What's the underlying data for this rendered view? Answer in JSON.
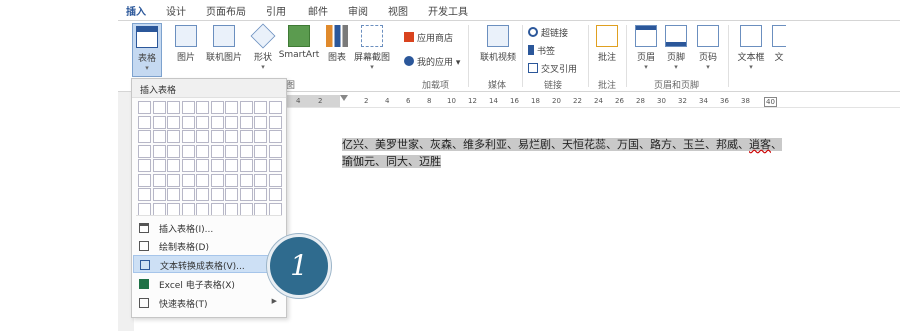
{
  "tabs": [
    "插入",
    "设计",
    "页面布局",
    "引用",
    "邮件",
    "审阅",
    "视图",
    "开发工具"
  ],
  "active_tab": "插入",
  "ribbon": {
    "table": "表格",
    "picture": "图片",
    "online_picture": "联机图片",
    "shapes": "形状",
    "smartart": "SmartArt",
    "chart": "图表",
    "screenshot": "屏幕截图",
    "app_store": "应用商店",
    "my_apps": "我的应用",
    "online_video": "联机视频",
    "hyperlink": "超链接",
    "bookmark": "书签",
    "cross_ref": "交叉引用",
    "comment": "批注",
    "header": "页眉",
    "footer": "页脚",
    "page_number": "页码",
    "textbox": "文本框",
    "groups": {
      "illustrations": "图",
      "addins": "加载项",
      "media": "媒体",
      "links": "链接",
      "comments": "批注",
      "header_footer": "页眉和页脚"
    }
  },
  "ruler": [
    "4",
    "2",
    "2",
    "4",
    "6",
    "8",
    "10",
    "12",
    "14",
    "16",
    "18",
    "20",
    "22",
    "24",
    "26",
    "28",
    "30",
    "32",
    "34",
    "36",
    "38",
    "40"
  ],
  "dropdown": {
    "header": "插入表格",
    "items": [
      "插入表格(I)...",
      "绘制表格(D)",
      "文本转换成表格(V)...",
      "Excel 电子表格(X)",
      "快速表格(T)"
    ]
  },
  "document": {
    "line1": "亿兴、美罗世家、灰森、维多利亚、易烂剧、天恒花蕊、万国、路方、玉兰、邦威、",
    "line1_underlined": "逍客",
    "line1_end": "、",
    "line2": "瑜伽元、同大、迈胜"
  },
  "step_badge": "1"
}
